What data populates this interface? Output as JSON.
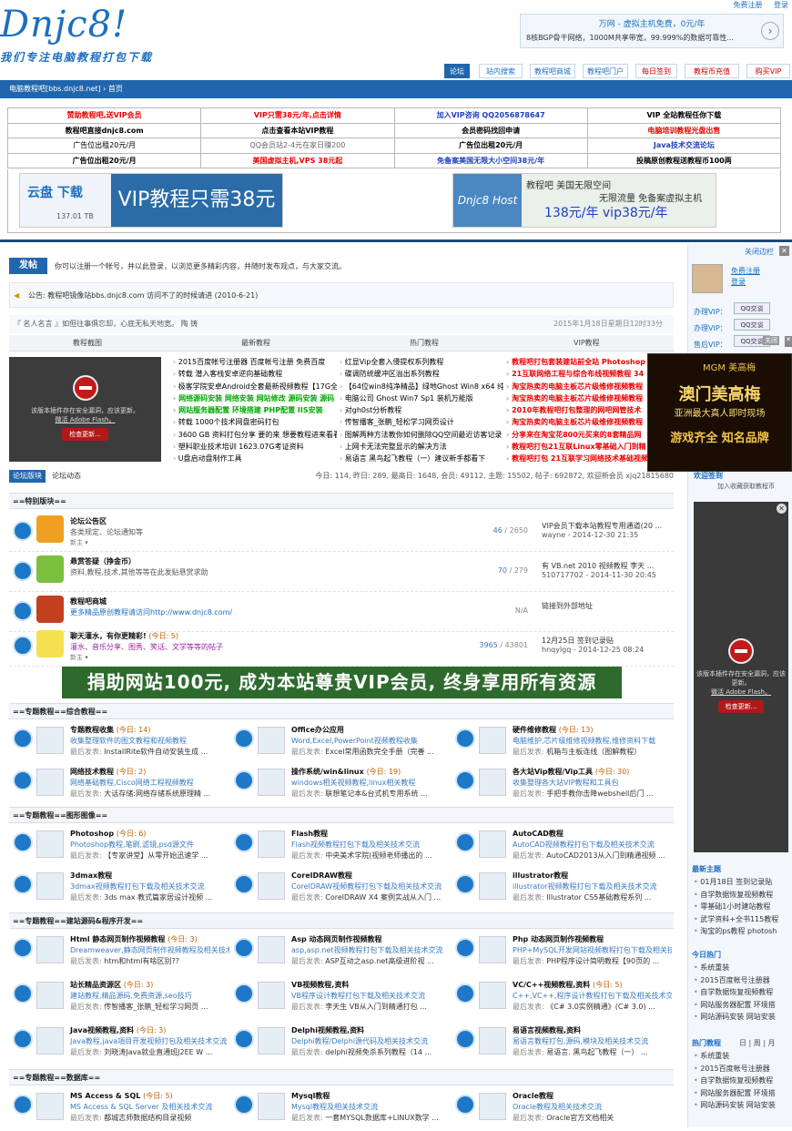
{
  "header": {
    "logo": "Dnjc8!",
    "slogan": "我们专注电脑教程打包下载",
    "register": "免费注册",
    "login": "登录",
    "ad_line1": "万网 - 虚拟主机免费，0元/年",
    "ad_line2": "8核BGP骨干网络，1000M共享带宽，99.999%的数据可靠性..."
  },
  "nav": [
    "论坛",
    "站内搜索",
    "教程吧商城",
    "教程吧门户",
    "每日签到",
    "教程币充值",
    "购买VIP"
  ],
  "breadcrumb": "电脑教程吧[bbs.dnjc8.net] › 首页",
  "ad_table": [
    [
      "赞助教程吧,送VIP会员",
      "VIP只需38元/年,点击详情",
      "加入VIP咨询 QQ2056878647",
      "VIP 全站教程任你下载"
    ],
    [
      "教程吧直接dnjc8.com",
      "点击查看本站VIP教程",
      "会员密码找回申请",
      "电脑培训教程光盘出售"
    ],
    [
      "广告位出租20元/月",
      "QQ会员站2-4元在家日赚200",
      "广告位出租20元/月",
      "Java技术交流论坛"
    ],
    [
      "广告位出租20元/月",
      "美国虚拟主机,VPS 38元起",
      "免备案美国无限大小空间38元/年",
      "投稿原创教程送教程币100两"
    ]
  ],
  "banner1": {
    "left_top": "云盘 下载",
    "left_bottom": "137.01 TB",
    "right": "VIP教程只需38元"
  },
  "banner2": {
    "left": "Dnjc8 Host",
    "line1": "教程吧 美国无限空间",
    "line2": "无限流量 免备案虚拟主机",
    "price": "138元/年 vip38元/年"
  },
  "post_btn": "发帖",
  "login_hint": "你可以注册一个帐号，并以此登录，以浏览更多精彩内容，并随时发布观点，与大家交流。",
  "notice": "公告:   教程吧镜像站bbs.dnjc8.com 访问不了的时候请进  (2010-6-21)",
  "quote": "『 名人名言 』如但往事俱忘却，心底无私天地宽。 陶 铸",
  "date": "2015年1月18日星期日12时33分",
  "col_headers": [
    "教程截图",
    "最新教程",
    "热门教程",
    "VIP教程"
  ],
  "flash": {
    "text1": "该版本插件存在安全漏洞，应该更新。",
    "text2": "微活 Adobe Flash。",
    "btn": "检查更新..."
  },
  "latest": [
    "2015百度帐号注册器 百度帐号注册 免费百度",
    "转载 潜入客栈安卓逆向基础教程",
    "极客学院安卓Android全套最新视频教程【17G全",
    "网络源码安装 网络安装 网站修改 源码安装 源码",
    "网站服务器配置 环境搭建 PHP配置 IIS安装",
    "转载 1000个技术网盘密码打包",
    "3600 GB 资料打包分享 要的来 想要教程进来看看",
    "塑料职业技术培训 1623.07G考证资料",
    "U盘启动盘制作工具"
  ],
  "hot": [
    "红显Vip全套入侵提权系列教程",
    "碟调防统缓冲区溢出系列教程",
    "【64位win8纯净精品】绿地Ghost Win8 x64 纯",
    "电脑公司 Ghost Win7 Sp1 装机万能版",
    "对gh0st分析教程",
    "传智播客_张鹏_轻松学习网页设计",
    "图解两种方法教你如何删除QQ空间最近访客记录",
    "上网卡无法完整显示的解决方法",
    "易语言 黑鸟起飞教程（一）建议新手都看下"
  ],
  "vip": [
    "教程吧打包套装建站前全站 Photoshop",
    "21互联网络工程与综合布线视频教程 34",
    "淘宝热卖的电脑主板芯片级维修视频教程",
    "淘宝热卖的电脑主板芯片级维修视频教程",
    "2010年教程吧打包整理的网吧网管技术",
    "淘宝热卖的电脑主板芯片级维修视频教程",
    "分享来在淘宝花800元买来的8套精品网",
    "教程吧打包21互联Linux零基础入门到精",
    "教程吧打包 21互联学习网络技术基础视频"
  ],
  "forum_tabs": {
    "t1": "论坛版块",
    "t2": "论坛动态",
    "stats": "今日: 114, 昨日: 289, 最高日: 1648, 会员: 49112, 主题: 15502, 帖子: 692872, 欢迎新会员 xjq21815680"
  },
  "sec1": "==特别版块==",
  "forums": [
    {
      "title": "论坛公告区",
      "today": "",
      "desc": "各类规定、论坛通知等",
      "mod": "新主 ▾",
      "threads": "46",
      "posts": " / 2650",
      "last1": "VIP会员下载本站教程专用通道(20 ...",
      "last2": "wayne - 2014-12-30 21:35"
    },
    {
      "title": "悬赏答疑（挣金币）",
      "today": "",
      "desc": "资料,教程,技术,其他等等在此发贴悬赏求助",
      "mod": "",
      "threads": "70",
      "posts": " / 279",
      "last1": "有 VB.net 2010 视频教程 李天 ...",
      "last2": "510717702 - 2014-11-30 20:45"
    },
    {
      "title": "教程吧商城",
      "today": "",
      "desc": "更多精品原创教程请访问http://www.dnjc8.com/",
      "mod": "",
      "threads": "",
      "posts": "N/A",
      "last1": "链接到外部地址",
      "last2": ""
    },
    {
      "title": "聊天灌水，有你更精彩!",
      "today": "(今日: 5)",
      "desc": "灌水、音乐分享、图秀、笑话、文学等等的帖子",
      "mod": "新主 ▾",
      "threads": "3965",
      "posts": " / 43801",
      "last1": "12月25日 签到记录贴",
      "last2": "hnqylgq - 2014-12-25 08:24"
    }
  ],
  "bigad": "捐助网站100元, 成为本站尊贵VIP会员, 终身享用所有资源",
  "sec2": "==专题教程==综合教程==",
  "grid1": [
    {
      "t": "专题教程收集",
      "td": "(今日: 14)",
      "d": "收集整理软件的图文教程和视频教程",
      "l": "InstallRite软件自动安装生成 ..."
    },
    {
      "t": "Office办公应用",
      "td": "",
      "d": "Word,Excel,PowerPoint视频教程收集",
      "l": "Excel常用函数完全手册（完善 ..."
    },
    {
      "t": "硬件维修教程",
      "td": "(今日: 13)",
      "d": "电脑维护,芯片级维修视频教程,维修资料下载",
      "l": "机箱与主板连线（图解教程）"
    },
    {
      "t": "网络技术教程",
      "td": "(今日: 2)",
      "d": "网络基础教程,Cisco网络工程视频教程",
      "l": "大话存储:网络存储系统原理精 ..."
    },
    {
      "t": "操作系统/win&linux",
      "td": "(今日: 19)",
      "d": "windows相关视频教程,linux相关教程",
      "l": "联想笔记本&台式机专用系统 ..."
    },
    {
      "t": "各大站Vip教程/Vip工具",
      "td": "(今日: 30)",
      "d": "收集整理各大站VIP教程和工具包",
      "l": "手把手教你击降webshell后门 ..."
    }
  ],
  "sec3": "==专题教程==图形图像==",
  "grid2": [
    {
      "t": "Photoshop",
      "td": "(今日: 6)",
      "d": "Photoshop教程,笔刷,滤镜,psd源文件",
      "l": "【专家讲堂】从零开始迅速学 ..."
    },
    {
      "t": "Flash教程",
      "td": "",
      "d": "Flash视频教程打包下载及相关技术交流",
      "l": "中央美术学院(视频老师播出的 ..."
    },
    {
      "t": "AutoCAD教程",
      "td": "",
      "d": "AutoCAD视频教程打包下载及相关技术交流",
      "l": "AutoCAD2013从入门到精通视频 ..."
    },
    {
      "t": "3dmax教程",
      "td": "",
      "d": "3dmax视频教程打包下载及相关技术交流",
      "l": "3ds max 教式篇家居设计视频 ..."
    },
    {
      "t": "CorelDRAW教程",
      "td": "",
      "d": "CorelDRAW视频教程打包下载及相关技术交流",
      "l": "CorelDRAW X4 案例实战从入门 ..."
    },
    {
      "t": "illustrator教程",
      "td": "",
      "d": "illustrator视频教程打包下载及相关技术交流",
      "l": "Illustrator CS5基础教程系列 ..."
    }
  ],
  "sec4": "==专题教程==建站源码&程序开发==",
  "grid3": [
    {
      "t": "Html 静态网页制作视频教程",
      "td": "(今日: 3)",
      "d": "Dreamweaver,静态网页制作视频教程及相关技术交流",
      "l": "htm和html有啥区别??"
    },
    {
      "t": "Asp 动态网页制作视频教程",
      "td": "",
      "d": "asp,asp.net视频教程打包下载及相关技术交流",
      "l": "ASP互动之asp.net高级进阶视 ..."
    },
    {
      "t": "Php 动态网页制作视频教程",
      "td": "",
      "d": "PHP+MySQL开发网站视频教程打包下载及相关技术交流",
      "l": "PHP程序设计简明教程【90页的 ..."
    },
    {
      "t": "站长精品资源区",
      "td": "(今日: 3)",
      "d": "建站教程,精品源码,免费资源,seo技巧",
      "l": "传智播客_张鹏_轻松学习网页 ..."
    },
    {
      "t": "VB视频教程,资料",
      "td": "",
      "d": "VB程序设计教程打包下载及相关技术交流",
      "l": "李天生 VB从入门到精通打包 ..."
    },
    {
      "t": "VC/C++视频教程,资料",
      "td": "(今日: 5)",
      "d": "C++,VC++,程序设计教程打包下载及相关技术交流",
      "l": "《C# 3.0实例精通》(C# 3.0) ..."
    },
    {
      "t": "Java视频教程,资料",
      "td": "(今日: 3)",
      "d": "Java教程,java項目开发视频打包及相关技术交流",
      "l": "刘晓涛Java就业直通班J2EE W ..."
    },
    {
      "t": "Delphi视频教程,资料",
      "td": "",
      "d": "Delphi教程/Delphi源代码及相关技术交流",
      "l": "delphi视频免杀系列教程（14 ..."
    },
    {
      "t": "易语言视频教程,资料",
      "td": "",
      "d": "易语言教程打包,源码,模块及相关技术交流",
      "l": "易语言. 黑鸟起飞教程（一） ..."
    }
  ],
  "sec5": "==专题教程==数据库==",
  "grid4": [
    {
      "t": "MS Access & SQL",
      "td": "(今日: 5)",
      "d": "MS Access & SQL Server 及相关技术交流",
      "l": "都城志师数据结构目录视频"
    },
    {
      "t": "Mysql教程",
      "td": "",
      "d": "Mysql教程及相关技术交流",
      "l": "一套MYSQL数据库+LINUX数学 ..."
    },
    {
      "t": "Oracle教程",
      "td": "",
      "d": "Oracle教程及相关技术交流",
      "l": "Oracle官方文档相关"
    }
  ],
  "last_label": "最后发表:",
  "side": {
    "close": "关闭边栏",
    "reg": "免费注册",
    "login": "登录",
    "vip_labels": [
      "办理VIP：",
      "办理VIP：",
      "售后VIP："
    ],
    "qq": "QQ交谈",
    "mgm_top": "MGM 美高梅",
    "mgm_a": "澳门美高梅",
    "mgm_b": "亚洲最大真人即时现场",
    "mgm_c": "游戏齐全 知名品牌",
    "ad_close": "关闭",
    "collect": "欢迎签到",
    "collect2": "加入收藏获取教程币",
    "new_title": "最新主题",
    "new_items": [
      "01月18日 签到记录贴",
      "自学数据恢复视频教程",
      "零基础1小时建站教程",
      "武学资料+全书115教程",
      "淘宝的ps教程 photosh"
    ],
    "today_title": "今日热门",
    "today_items": [
      "系统重装",
      "2015百度帐号注册器",
      "自学数据恢复视频教程",
      "网站服务器配置 环境搭",
      "网站源码安装 网站安装"
    ],
    "hot_title": "热门教程",
    "hot_tabs": "日 | 周 | 月",
    "hot_items": [
      "系统重装",
      "2015百度帐号注册器",
      "自学数据恢复视频教程",
      "网站服务器配置 环境搭",
      "网站源码安装 网站安装"
    ]
  }
}
